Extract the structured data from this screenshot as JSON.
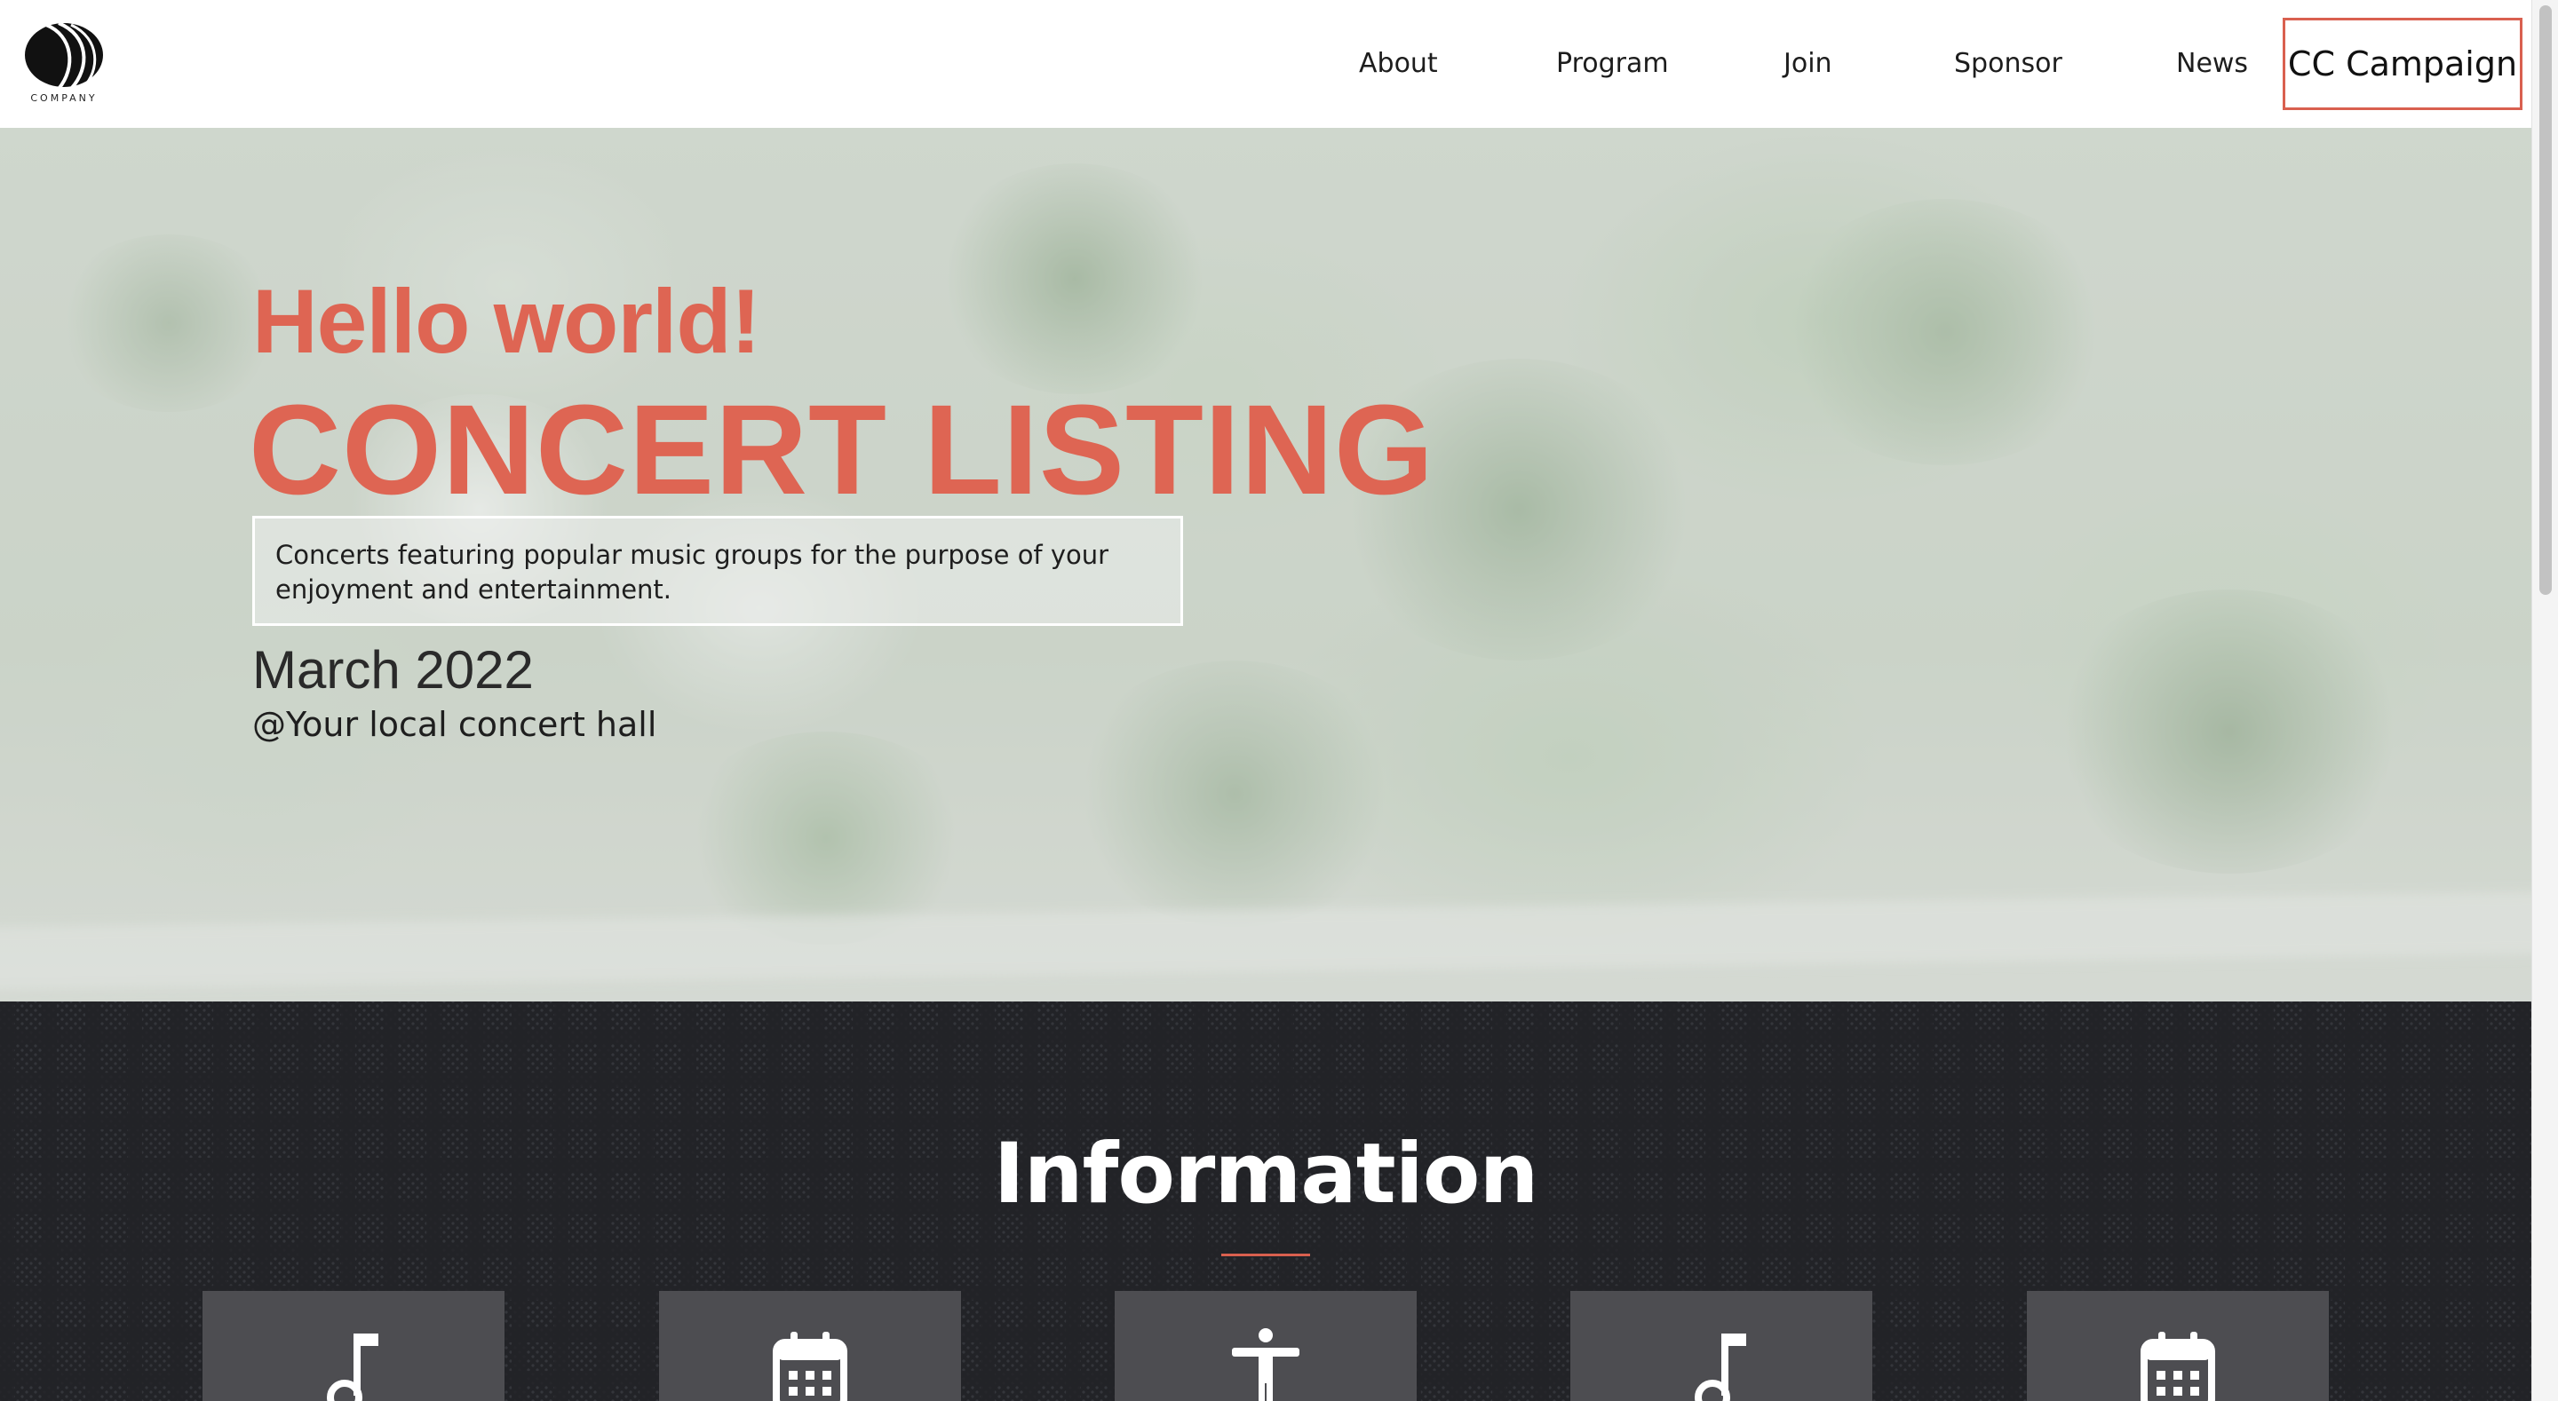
{
  "header": {
    "logo_text": "COMPANY",
    "nav": {
      "about": "About",
      "program": "Program",
      "join": "Join",
      "sponsor": "Sponsor",
      "news": "News",
      "cta": "CC Campaign"
    }
  },
  "hero": {
    "greeting": "Hello world!",
    "title": "CONCERT LISTING",
    "description": "Concerts featuring popular music groups for the purpose of your enjoyment and entertainment.",
    "date": "March 2022",
    "venue": "@Your local concert hall"
  },
  "info": {
    "title": "Information",
    "cards": [
      {
        "icon": "music-note-icon"
      },
      {
        "icon": "calendar-icon"
      },
      {
        "icon": "person-icon"
      },
      {
        "icon": "music-note-icon"
      },
      {
        "icon": "calendar-icon"
      }
    ]
  },
  "colors": {
    "accent": "#de6553",
    "dark_bg": "#222327",
    "card_bg": "#4d4d51"
  }
}
